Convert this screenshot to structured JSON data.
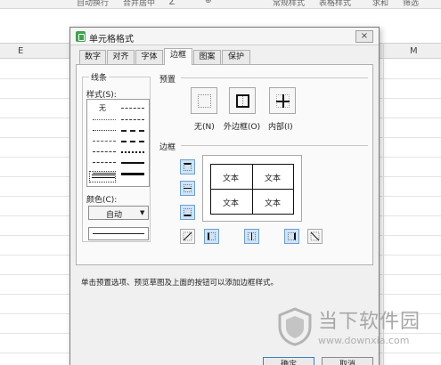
{
  "toolbar": {
    "items": [
      "自动换行",
      "合并居中",
      "∑",
      "⊕",
      "常规样式",
      "表格样式",
      "求和",
      "筛选"
    ]
  },
  "sheet": {
    "columns": [
      "E",
      "M"
    ]
  },
  "dialog": {
    "title": "单元格格式",
    "close": "×",
    "tabs": [
      "数字",
      "对齐",
      "字体",
      "边框",
      "图案",
      "保护"
    ],
    "active_tab": "边框",
    "line": {
      "group_label": "线条",
      "style_label": "样式(S):",
      "none_label": "无",
      "color_label": "颜色(C):",
      "color_value": "自动",
      "color_caret": "▼"
    },
    "presets": {
      "label": "预置",
      "items": [
        "无(N)",
        "外边框(O)",
        "内部(I)"
      ]
    },
    "border": {
      "label": "边框",
      "cells": [
        "文本",
        "文本",
        "文本",
        "文本"
      ]
    },
    "hint": "单击预置选项、预览草图及上面的按钮可以添加边框样式。",
    "ok": "确定",
    "cancel": "取消"
  },
  "watermark": {
    "name": "当下软件园",
    "url": "www.downxia.com"
  },
  "colors": {
    "accent": "#3c7fc4",
    "selected_side": "#cfe3f6",
    "watermark": "#a7a7a7"
  }
}
